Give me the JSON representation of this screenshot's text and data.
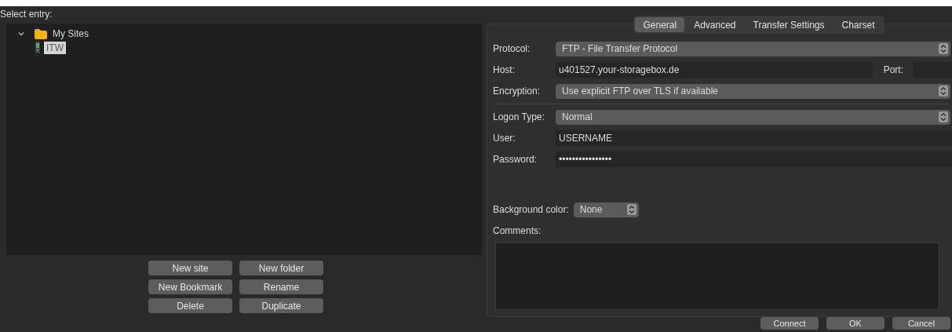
{
  "site_manager": {
    "label": "Select entry:",
    "tree": [
      {
        "label": "My Sites",
        "kind": "folder",
        "expanded": true,
        "selected": false,
        "children": [
          {
            "label": "ITW",
            "kind": "site",
            "selected": true
          }
        ]
      }
    ],
    "buttons": [
      "New site",
      "New folder",
      "New Bookmark",
      "Rename",
      "Delete",
      "Duplicate"
    ]
  },
  "tabs": [
    {
      "label": "General",
      "selected": true
    },
    {
      "label": "Advanced",
      "selected": false
    },
    {
      "label": "Transfer Settings",
      "selected": false
    },
    {
      "label": "Charset",
      "selected": false
    }
  ],
  "general": {
    "protocol": {
      "label": "Protocol:",
      "value": "FTP - File Transfer Protocol"
    },
    "host": {
      "label": "Host:",
      "value": "u401527.your-storagebox.de"
    },
    "port": {
      "label": "Port:"
    },
    "encryption": {
      "label": "Encryption:",
      "value": "Use explicit FTP over TLS if available"
    },
    "logon_type": {
      "label": "Logon Type:",
      "value": "Normal"
    },
    "user": {
      "label": "User:",
      "value": "USERNAME"
    },
    "password": {
      "label": "Password:",
      "value": "••••••••••••••••"
    },
    "background_color": {
      "label": "Background color:",
      "value": "None"
    },
    "comments": {
      "label": "Comments:"
    }
  },
  "dialog_buttons": [
    "Connect",
    "OK",
    "Cancel"
  ]
}
